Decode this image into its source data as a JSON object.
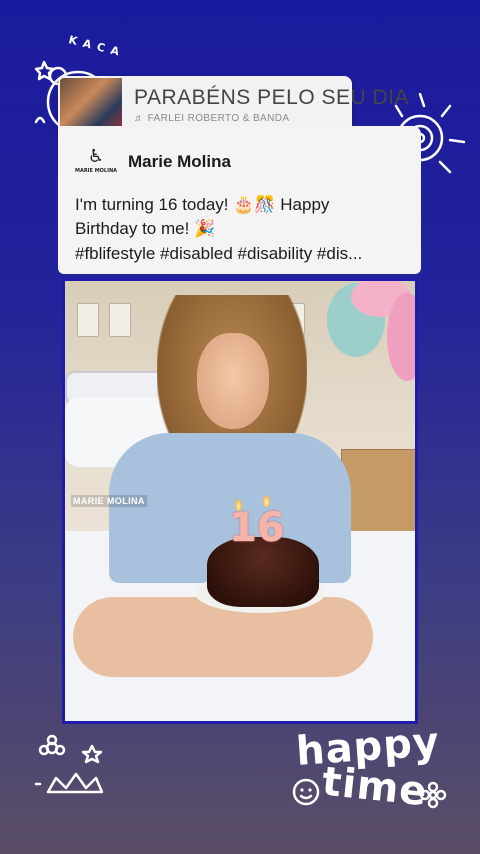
{
  "music": {
    "title": "PARABÉNS PELO SEU DIA",
    "artist": "FARLEI ROBERTO & BANDA",
    "note_icon": "♬"
  },
  "post": {
    "page_name": "Marie Molina",
    "logo_label": "MARIE MOLINA",
    "text_line1": "I'm turning 16 today! 🎂🎊 Happy",
    "text_line2": "Birthday to me! 🎉",
    "hashtags": "#fblifestyle #disabled #disability #dis..."
  },
  "photo": {
    "watermark": "MARIE MOLINA",
    "candle_number": "16"
  },
  "stickers": {
    "kaca": "KACA",
    "happy": "happy",
    "time": "time"
  },
  "colors": {
    "background_top": "#1a1a9e",
    "background_bottom": "#5a4e66",
    "photo_border": "#1d1daa"
  }
}
